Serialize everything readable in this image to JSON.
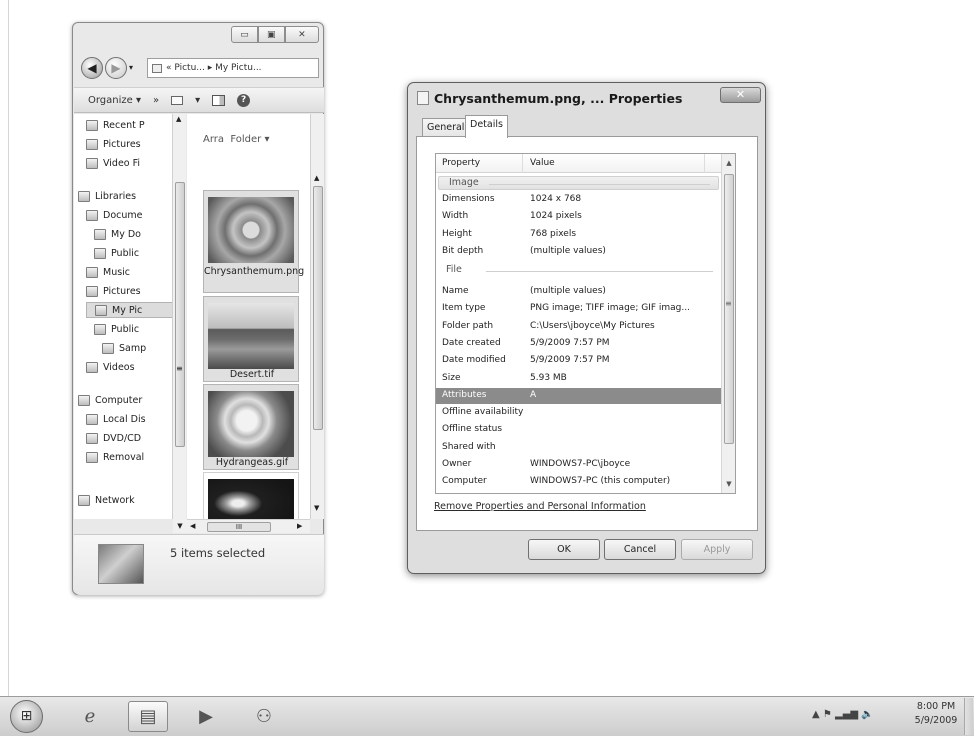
{
  "explorer": {
    "window_buttons": [
      "▭",
      "▣",
      "✕"
    ],
    "address": "« Pictu... ▸ My Pictu...",
    "toolbar": {
      "organize": "Organize ▾",
      "more": "»"
    },
    "nav_items": [
      {
        "label": "Recent P",
        "icon": "recent-places-icon"
      },
      {
        "label": "Pictures",
        "icon": "pictures-icon"
      },
      {
        "label": "Video Fi",
        "icon": "video-files-icon"
      },
      {
        "label": "Libraries",
        "icon": "libraries-icon"
      },
      {
        "label": "Docume",
        "icon": "documents-icon"
      },
      {
        "label": "My Do",
        "icon": "folder-icon"
      },
      {
        "label": "Public",
        "icon": "folder-icon"
      },
      {
        "label": "Music",
        "icon": "music-icon"
      },
      {
        "label": "Pictures",
        "icon": "pictures-icon"
      },
      {
        "label": "My Pic",
        "icon": "folder-icon",
        "selected": true
      },
      {
        "label": "Public",
        "icon": "folder-icon"
      },
      {
        "label": "Samp",
        "icon": "folder-icon"
      },
      {
        "label": "Videos",
        "icon": "videos-icon"
      },
      {
        "label": "Computer",
        "icon": "computer-icon"
      },
      {
        "label": "Local Dis",
        "icon": "drive-icon"
      },
      {
        "label": "DVD/CD",
        "icon": "dvd-drive-icon"
      },
      {
        "label": "Removal",
        "icon": "removable-drive-icon"
      },
      {
        "label": "Network",
        "icon": "network-icon"
      }
    ],
    "arrange_label": "Arra",
    "arrange_value": "Folder ▾",
    "files": [
      {
        "name": "Chrysanthemum.png"
      },
      {
        "name": "Desert.tif"
      },
      {
        "name": "Hydrangeas.gif"
      },
      {
        "name": ""
      }
    ],
    "hscroll_thumb": "III",
    "status": "5 items selected"
  },
  "dialog": {
    "title": "Chrysanthemum.png, ... Properties",
    "close": "✕",
    "tabs": [
      "General",
      "Details"
    ],
    "columns": {
      "property": "Property",
      "value": "Value"
    },
    "groups": {
      "image": "Image",
      "file": "File"
    },
    "image_rows": [
      {
        "p": "Dimensions",
        "v": "1024 x 768"
      },
      {
        "p": "Width",
        "v": "1024 pixels"
      },
      {
        "p": "Height",
        "v": "768 pixels"
      },
      {
        "p": "Bit depth",
        "v": "(multiple values)"
      }
    ],
    "file_rows": [
      {
        "p": "Name",
        "v": "(multiple values)"
      },
      {
        "p": "Item type",
        "v": "PNG image; TIFF image; GIF imag..."
      },
      {
        "p": "Folder path",
        "v": "C:\\Users\\jboyce\\My Pictures"
      },
      {
        "p": "Date created",
        "v": "5/9/2009 7:57 PM"
      },
      {
        "p": "Date modified",
        "v": "5/9/2009 7:57 PM"
      },
      {
        "p": "Size",
        "v": "5.93 MB"
      },
      {
        "p": "Attributes",
        "v": "A",
        "selected": true
      },
      {
        "p": "Offline availability",
        "v": ""
      },
      {
        "p": "Offline status",
        "v": ""
      },
      {
        "p": "Shared with",
        "v": ""
      },
      {
        "p": "Owner",
        "v": "WINDOWS7-PC\\jboyce"
      },
      {
        "p": "Computer",
        "v": "WINDOWS7-PC (this computer)"
      }
    ],
    "remove_link": "Remove Properties and Personal Information",
    "buttons": {
      "ok": "OK",
      "cancel": "Cancel",
      "apply": "Apply"
    }
  },
  "taskbar": {
    "clock_time": "8:00 PM",
    "clock_date": "5/9/2009",
    "tray": "▲  ⚑  ▂▄▆  🔈",
    "pinned": [
      {
        "icon": "internet-explorer-icon",
        "glyph": "ℯ"
      },
      {
        "icon": "windows-explorer-icon",
        "glyph": "▤",
        "running": true
      },
      {
        "icon": "media-player-icon",
        "glyph": "▶"
      },
      {
        "icon": "users-icon",
        "glyph": "⚇"
      }
    ]
  }
}
